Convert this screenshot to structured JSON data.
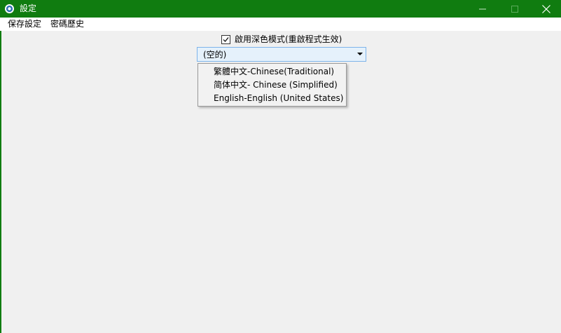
{
  "window": {
    "title": "設定",
    "accent_color": "#107c10",
    "controls": [
      "minimize-icon",
      "maximize-icon",
      "close-icon"
    ]
  },
  "menu": {
    "items": [
      {
        "label": "保存設定"
      },
      {
        "label": "密碼歷史"
      }
    ]
  },
  "settings": {
    "dark_mode_label": "啟用深色模式(重啟程式生效)",
    "dark_mode_checked": true,
    "language_combo_value": "(空的)",
    "language_options": [
      "繁體中文-Chinese(Traditional)",
      "简体中文- Chinese (Simplified)",
      "English-English (United States)"
    ]
  }
}
